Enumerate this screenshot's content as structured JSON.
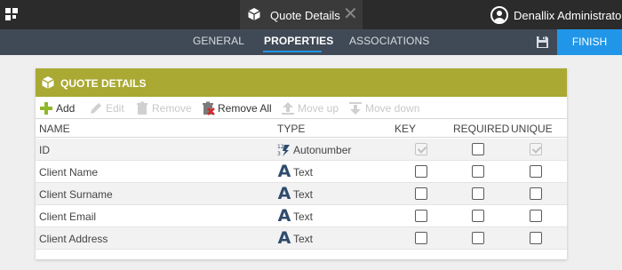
{
  "topbar": {
    "tab_title": "Quote Details",
    "user_name": "Denallix Administrator"
  },
  "nav": {
    "tabs": [
      {
        "label": "GENERAL",
        "active": false
      },
      {
        "label": "PROPERTIES",
        "active": true
      },
      {
        "label": "ASSOCIATIONS",
        "active": false
      }
    ],
    "finish_label": "FINISH"
  },
  "panel": {
    "title": "QUOTE DETAILS",
    "toolbar": {
      "add": "Add",
      "edit": "Edit",
      "remove": "Remove",
      "remove_all": "Remove All",
      "move_up": "Move up",
      "move_down": "Move down"
    },
    "columns": {
      "name": "NAME",
      "type": "TYPE",
      "key": "KEY",
      "required": "REQUIRED",
      "unique": "UNIQUE"
    },
    "rows": [
      {
        "name": "ID",
        "type": "Autonumber",
        "key": true,
        "key_disabled": true,
        "required": false,
        "unique": true,
        "unique_disabled": true
      },
      {
        "name": "Client Name",
        "type": "Text",
        "key": false,
        "required": false,
        "unique": false
      },
      {
        "name": "Client Surname",
        "type": "Text",
        "key": false,
        "required": false,
        "unique": false
      },
      {
        "name": "Client Email",
        "type": "Text",
        "key": false,
        "required": false,
        "unique": false
      },
      {
        "name": "Client Address",
        "type": "Text",
        "key": false,
        "required": false,
        "unique": false
      }
    ]
  },
  "colors": {
    "topbar": "#2b2b2b",
    "subnav": "#404a56",
    "accent_blue": "#2196e8",
    "panel_header": "#a9a933",
    "type_text_icon": "#2f4b6d"
  },
  "icons": {
    "app": "grid-icon",
    "tab": "cube-icon",
    "close": "close-icon",
    "user": "user-icon",
    "save": "floppy-disk-icon"
  }
}
